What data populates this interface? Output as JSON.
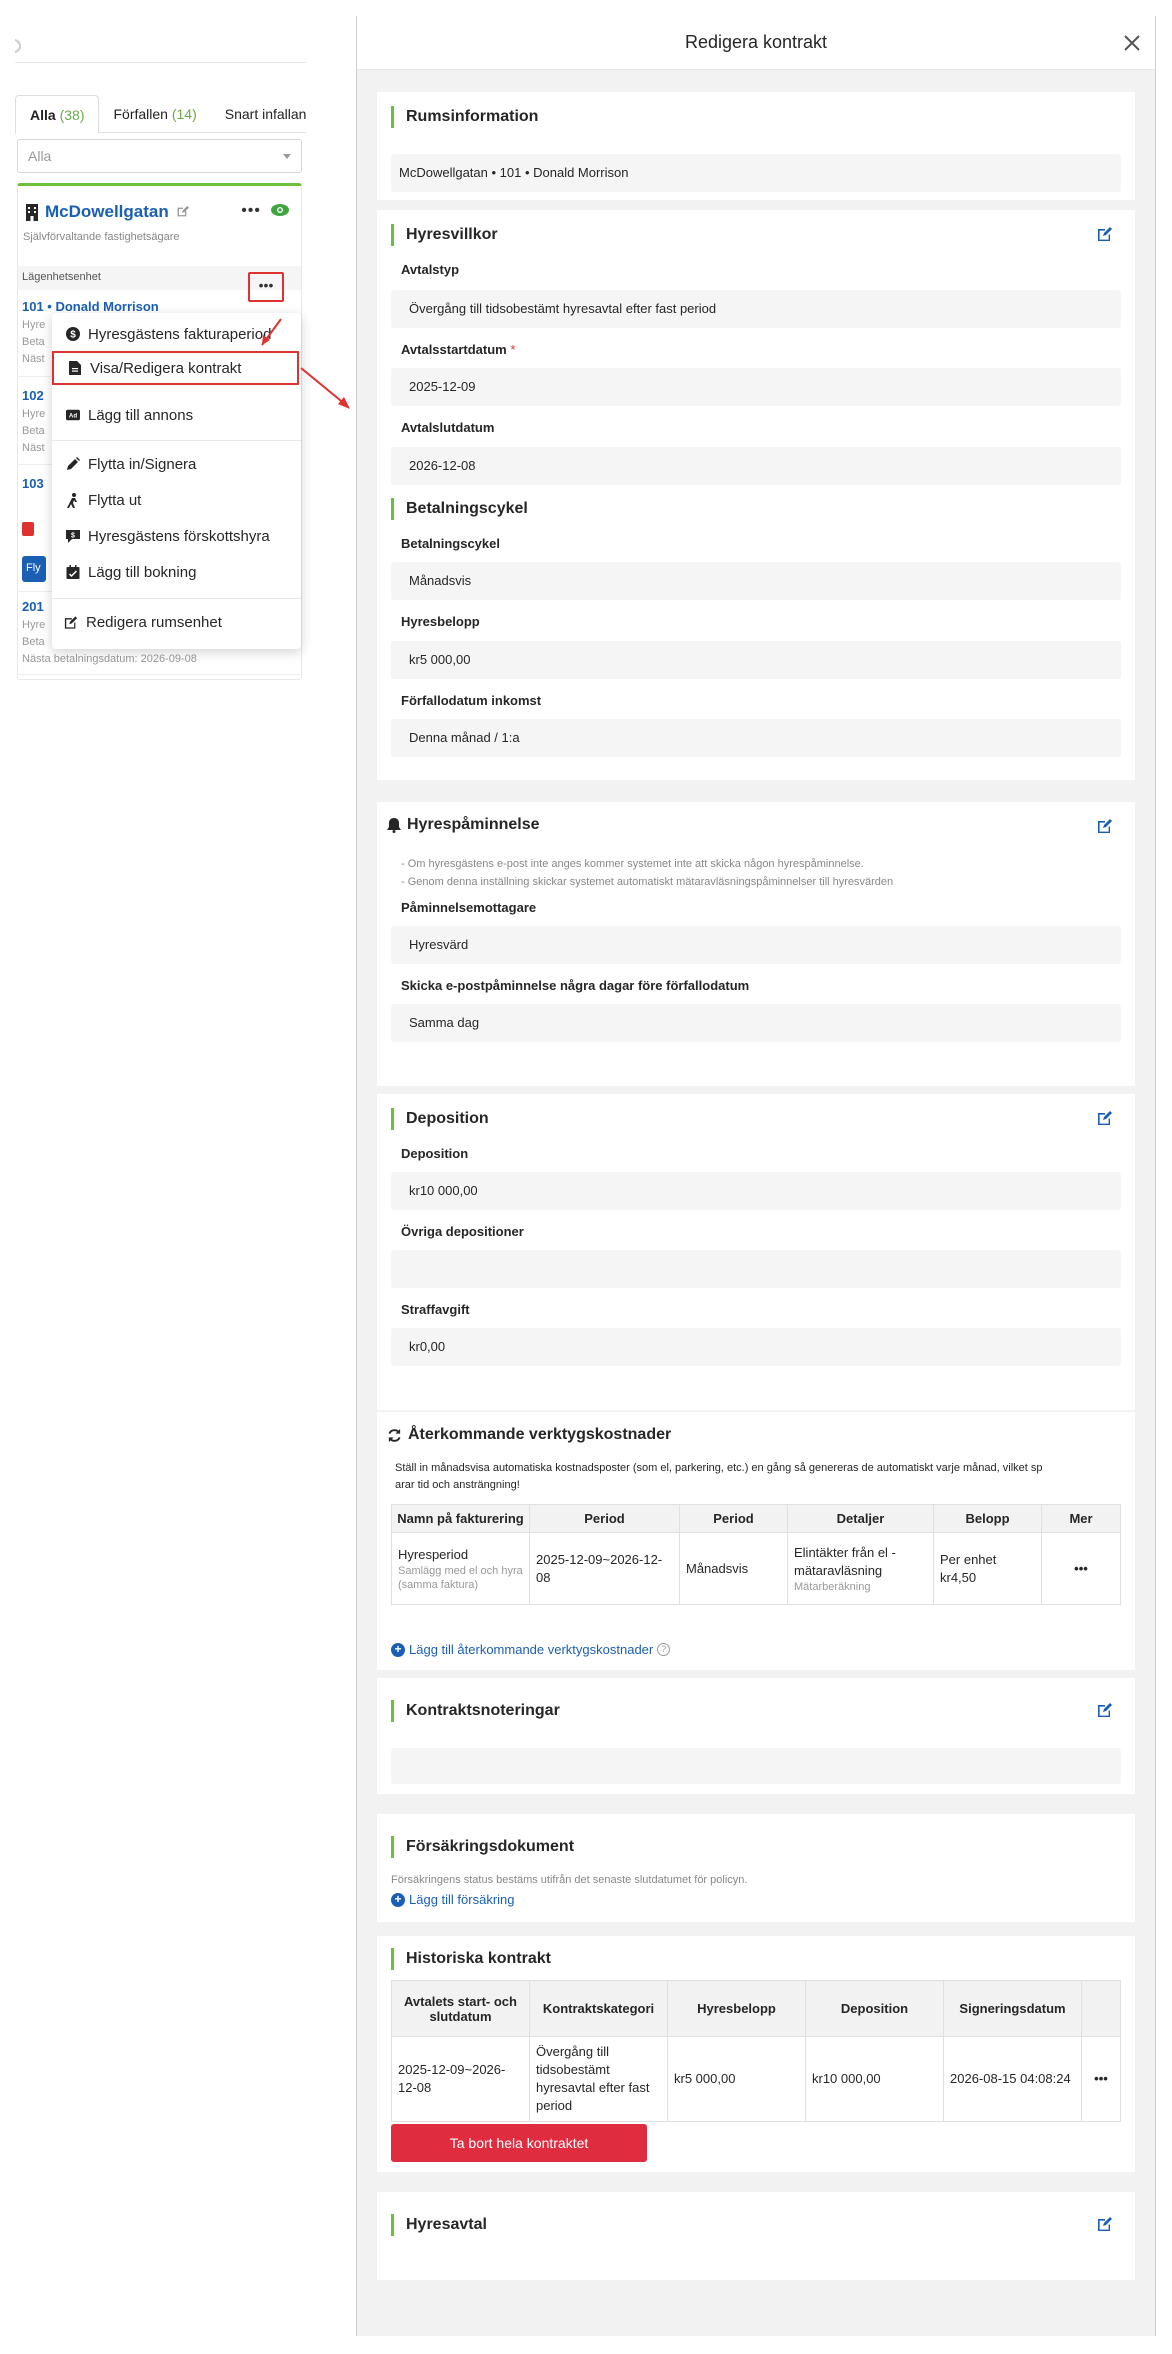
{
  "left": {
    "tabs": [
      {
        "label": "Alla",
        "count": "(38)"
      },
      {
        "label": "Förfallen",
        "count": "(14)"
      },
      {
        "label": "Snart infallan",
        "count": ""
      }
    ],
    "filter_placeholder": "Alla",
    "property": {
      "name": "McDowellgatan",
      "subtitle": "Självförvaltande fastighetsägare",
      "units_label": "Lägenhetsenhet"
    },
    "units": [
      {
        "title": "101 • Donald Morrison",
        "line1": "Hyre",
        "line2": "Beta",
        "line3": "Näst"
      },
      {
        "title": "102",
        "line1": "Hyre",
        "line2": "Beta",
        "line3": "Näst"
      },
      {
        "title": "103",
        "badge_text": "Fly"
      },
      {
        "title": "201",
        "line1": "Hyre",
        "line2": "Beta",
        "line3": "Nästa betalningsdatum: 2026-09-08"
      }
    ],
    "more_label": "•••",
    "menu": [
      {
        "label": "Hyresgästens fakturaperiod",
        "icon": "dollar-icon"
      },
      {
        "label": "Visa/Redigera kontrakt",
        "icon": "document-icon"
      },
      {
        "label": "Lägg till annons",
        "icon": "ad-icon"
      },
      {
        "label": "Flytta in/Signera",
        "icon": "pen-icon"
      },
      {
        "label": "Flytta ut",
        "icon": "walk-icon"
      },
      {
        "label": "Hyresgästens förskottshyra",
        "icon": "prepay-icon"
      },
      {
        "label": "Lägg till bokning",
        "icon": "calendar-check-icon"
      },
      {
        "label": "Redigera rumsenhet",
        "icon": "edit-icon"
      }
    ]
  },
  "modal": {
    "title": "Redigera kontrakt",
    "room_info": {
      "title": "Rumsinformation",
      "value": "McDowellgatan • 101 • Donald Morrison"
    },
    "terms": {
      "title": "Hyresvillkor",
      "contract_type_label": "Avtalstyp",
      "contract_type": "Övergång till tidsobestämt hyresavtal efter fast period",
      "start_label": "Avtalsstartdatum",
      "start_required": "*",
      "start": "2025-12-09",
      "end_label": "Avtalslutdatum",
      "end": "2026-12-08",
      "payment_title": "Betalningscykel",
      "cycle_label": "Betalningscykel",
      "cycle": "Månadsvis",
      "amount_label": "Hyresbelopp",
      "amount": "kr5 000,00",
      "due_label": "Förfallodatum inkomst",
      "due": "Denna månad / 1:a"
    },
    "reminder": {
      "title": "Hyrespåminnelse",
      "note1": "- Om hyresgästens e-post inte anges kommer systemet inte att skicka någon hyrespåminnelse.",
      "note2": "- Genom denna inställning skickar systemet automatiskt mätaravläsningspåminnelser till hyresvärden",
      "recipient_label": "Påminnelsemottagare",
      "recipient": "Hyresvärd",
      "days_label": "Skicka e-postpåminnelse några dagar före förfallodatum",
      "days": "Samma dag"
    },
    "deposit": {
      "title": "Deposition",
      "deposit_label": "Deposition",
      "deposit": "kr10 000,00",
      "other_label": "Övriga depositioner",
      "other": "",
      "penalty_label": "Straffavgift",
      "penalty": "kr0,00"
    },
    "utilities": {
      "title": "Återkommande verktygskostnader",
      "desc_a": "Ställ in månadsvisa automatiska kostnadsposter (som el, parkering, etc.) en gång så genereras de automatiskt varje månad, vilket sp",
      "desc_b": "arar tid och ansträngning!",
      "headers": [
        "Namn på fakturering",
        "Period",
        "Period",
        "Detaljer",
        "Belopp",
        "Mer"
      ],
      "row": {
        "name": "Hyresperiod",
        "name_sub": "Samlägg med el och hyra (samma faktura)",
        "period": "2025-12-09~2026-12-08",
        "cycle": "Månadsvis",
        "details": "Elintäkter från el - mätaravläsning",
        "details_sub": "Mätarberäkning",
        "amount": "Per enhet kr4,50",
        "more": "•••"
      },
      "add_label": "Lägg till återkommande verktygskostnader",
      "help": "?"
    },
    "notes": {
      "title": "Kontraktsnoteringar",
      "value": ""
    },
    "insurance": {
      "title": "Försäkringsdokument",
      "note": "Försäkringens status bestäms utifrån det senaste slutdatumet för policyn.",
      "add_label": "Lägg till försäkring"
    },
    "history": {
      "title": "Historiska kontrakt",
      "headers": [
        "Avtalets start- och slutdatum",
        "Kontraktskategori",
        "Hyresbelopp",
        "Deposition",
        "Signeringsdatum",
        ""
      ],
      "row": {
        "dates": "2025-12-09~2026-12-08",
        "category": "Övergång till tidsobestämt hyresavtal efter fast period",
        "rent": "kr5 000,00",
        "deposit": "kr10 000,00",
        "signed": "2026-08-15 04:08:24",
        "more": "•••"
      },
      "delete_label": "Ta bort hela kontraktet"
    },
    "lease": {
      "title": "Hyresavtal"
    }
  }
}
